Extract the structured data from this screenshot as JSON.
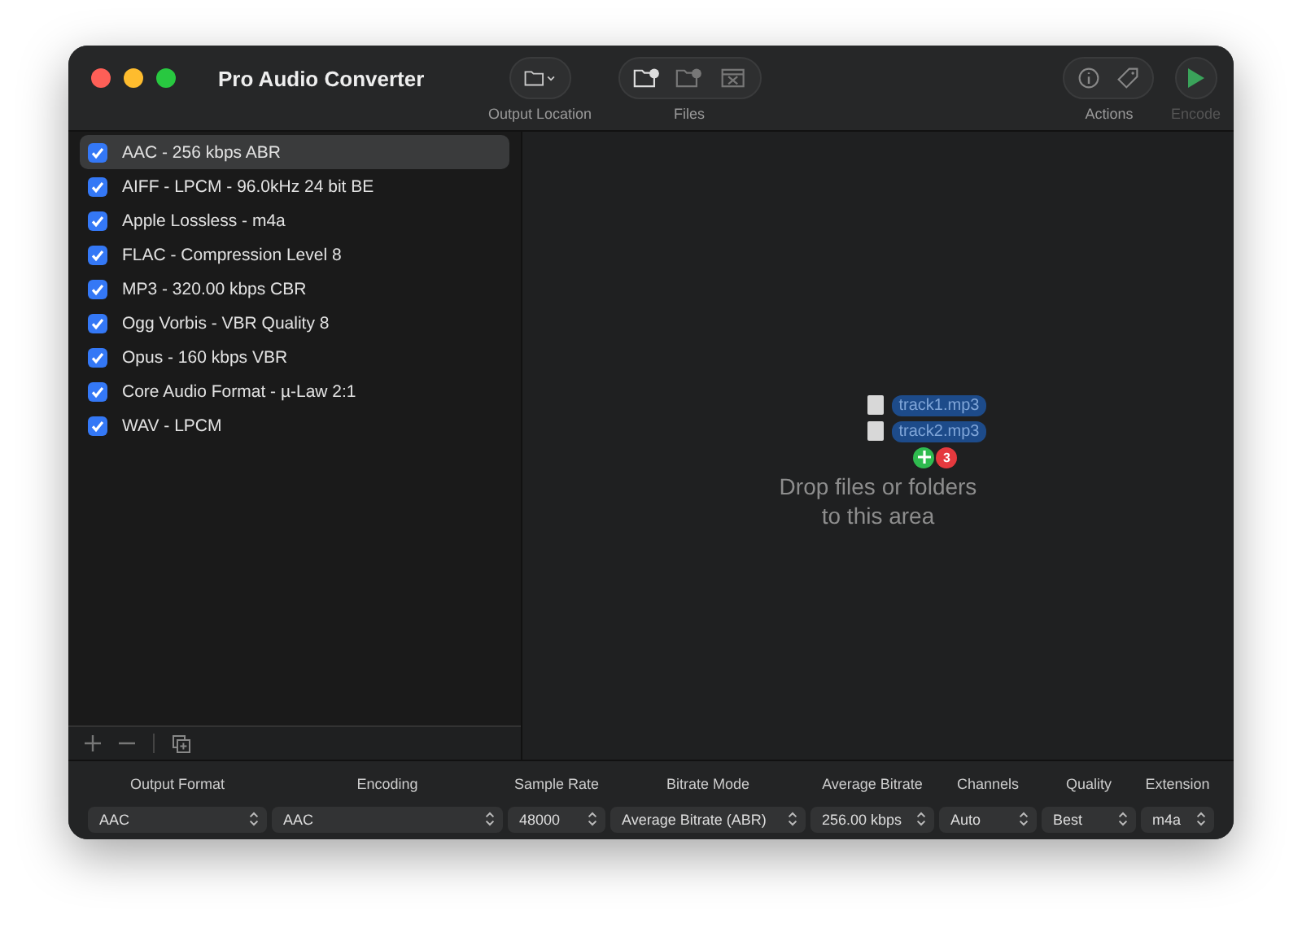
{
  "window": {
    "title": "Pro Audio Converter"
  },
  "toolbar": {
    "groups": [
      {
        "label": "Output Location",
        "kind": "location"
      },
      {
        "label": "Files",
        "kind": "files"
      },
      {
        "label": "Actions",
        "kind": "actions"
      },
      {
        "label": "Encode",
        "kind": "encode",
        "disabled": true
      }
    ]
  },
  "presets": [
    {
      "label": "AAC - 256 kbps ABR",
      "checked": true,
      "selected": true
    },
    {
      "label": "AIFF - LPCM - 96.0kHz 24 bit BE",
      "checked": true,
      "selected": false
    },
    {
      "label": "Apple Lossless - m4a",
      "checked": true,
      "selected": false
    },
    {
      "label": "FLAC - Compression Level 8",
      "checked": true,
      "selected": false
    },
    {
      "label": "MP3 - 320.00 kbps CBR",
      "checked": true,
      "selected": false
    },
    {
      "label": "Ogg Vorbis - VBR Quality 8",
      "checked": true,
      "selected": false
    },
    {
      "label": "Opus - 160 kbps VBR",
      "checked": true,
      "selected": false
    },
    {
      "label": "Core Audio Format - µ-Law 2:1",
      "checked": true,
      "selected": false
    },
    {
      "label": "WAV - LPCM",
      "checked": true,
      "selected": false
    }
  ],
  "drop_area": {
    "lines": [
      "Drop files or folders",
      "to this area"
    ],
    "dragged_files": [
      "track1.mp3",
      "track2.mp3"
    ],
    "drag_count": "3"
  },
  "settings": [
    {
      "label": "Output Format",
      "value": "AAC"
    },
    {
      "label": "Encoding",
      "value": "AAC"
    },
    {
      "label": "Sample Rate",
      "value": "48000"
    },
    {
      "label": "Bitrate Mode",
      "value": "Average Bitrate (ABR)"
    },
    {
      "label": "Average Bitrate",
      "value": "256.00 kbps"
    },
    {
      "label": "Channels",
      "value": "Auto"
    },
    {
      "label": "Quality",
      "value": "Best"
    },
    {
      "label": "Extension",
      "value": "m4a"
    }
  ]
}
